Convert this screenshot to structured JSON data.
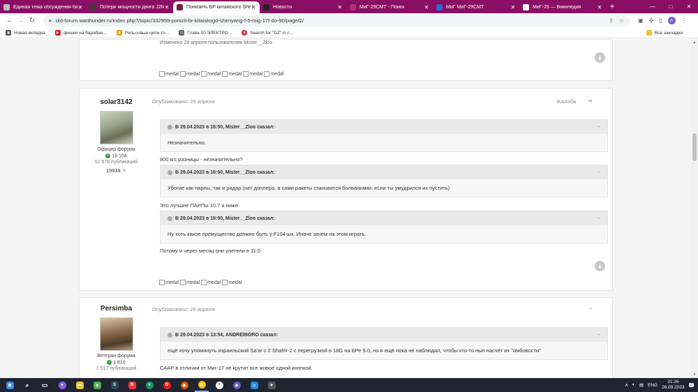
{
  "tabs": [
    {
      "title": "Единая тема обсуждения бала",
      "fav_color": "#c0c0c0",
      "active": false
    },
    {
      "title": "Потери мощности двига J2M5",
      "fav_color": "#3b3b3b",
      "active": false
    },
    {
      "title": "Понизить БР китайского Sheny",
      "fav_color": "#7a1f3d",
      "active": true
    },
    {
      "title": "Новости",
      "fav_color": "#222222",
      "active": false
    },
    {
      "title": "МиГ-29СМТ - Поиск",
      "fav_color": "#8a0e63",
      "active": false
    },
    {
      "title": "МиГ МиГ-29СМТ",
      "fav_color": "#2a6ad0",
      "active": false
    },
    {
      "title": "МиГ-29 — Википедия",
      "fav_color": "#ffffff",
      "active": false
    }
  ],
  "new_tab_label": "+",
  "window_controls": {
    "minimize": "—",
    "maximize": "□",
    "close": "✕"
  },
  "address": {
    "url": "old-forum.warthunder.ru/index.php?/topic/332959-ponizit-br-kitaiskogo-shenyang-f-5-mig-17f-do-90/page/2/"
  },
  "profile_initial": "A",
  "bookmarks": [
    {
      "label": "Новая вкладка",
      "color": "#555555"
    },
    {
      "label": "фишки на барабан...",
      "color": "#e02020"
    },
    {
      "label": "Рельсовые цепи то...",
      "color": "#f0a000"
    },
    {
      "label": "Глава 10 ЭЛЕКТРО...",
      "color": "#666666"
    },
    {
      "label": "Search for \"DZ\" in r...",
      "color": "#e03030"
    }
  ],
  "bookmarks_all": "Все закладки",
  "post0": {
    "edited": "Изменено 29 апреля пользователем Mister__Zloo",
    "medals": [
      "medal",
      "medal",
      "medal",
      "medal",
      "medal",
      "medal"
    ]
  },
  "post1": {
    "author": "solar3142",
    "rank": "Офицер форума",
    "reputation": "19 104",
    "posts": "51 978 публикаций",
    "extra": "19939",
    "published": "Опубликовано: 29 апреля",
    "report": "Жалоба",
    "quotes": [
      {
        "header": "В 29.04.2023 в 16:50, Mister__Zloo сказал:",
        "text": "Незначительно."
      },
      {
        "header": "В 29.04.2023 в 16:50, Mister__Zloo сказал:",
        "text": "Убогие как парпы, так и радар (нет доплера, а сами ракеты становятся болванками, если ты умудрился их пустить)"
      },
      {
        "header": "В 29.04.2023 в 16:50, Mister__Zloo сказал:",
        "text": "Ну хоть какое премущество должно быть у F104-ых. Иначе зачем на этом играть."
      }
    ],
    "replies": [
      "800 кгс разницы - незначительно?",
      "Это лучшие ПАРПы 10.7 и ниже.",
      "Потому и через месяц они улетели в 11.0."
    ],
    "medals": [
      "medal",
      "medal",
      "medal",
      "medal"
    ]
  },
  "post2": {
    "author": "Persimba",
    "rank": "Ветеран форума",
    "reputation": "1 810",
    "posts": "1 517 публикаций",
    "published": "Опубликовано: 29 апреля",
    "quote": {
      "header": "В 29.04.2023 в 13:54, ANDREIBORO сказал:",
      "text": "ещё хочу упомянуть израильский Sa'ar с 2 Shafrir-2 с перегрузкой в 18G на БРе 9.0, но я ещё пока не наблюдал, чтобы кто-то нып насчёт их \"имбовости\""
    },
    "reply": "СААР в отличии от Миг-17 не крутит все живое одной кнопкой."
  },
  "taskbar": {
    "apps": [
      {
        "name": "windows",
        "color": "#3a8ee6",
        "glyph": "⊞"
      },
      {
        "name": "search",
        "color": "#1f2430",
        "glyph": "⌕"
      },
      {
        "name": "taskview",
        "color": "#1f2430",
        "glyph": "▭"
      },
      {
        "name": "app1",
        "color": "#8a5cf0",
        "glyph": "●"
      },
      {
        "name": "explorer",
        "color": "#f2c230",
        "glyph": "▬"
      },
      {
        "name": "app2",
        "color": "#4caf50",
        "glyph": "◆"
      },
      {
        "name": "steam",
        "color": "#2a475e",
        "glyph": "S"
      },
      {
        "name": "yandex",
        "color": "#e53935",
        "glyph": "Я"
      },
      {
        "name": "edge",
        "color": "#0f9d58",
        "glyph": "e"
      },
      {
        "name": "opera",
        "color": "#e02020",
        "glyph": "O"
      },
      {
        "name": "app3",
        "color": "#e65100",
        "glyph": "◉"
      },
      {
        "name": "chrome",
        "color": "#fbbc05",
        "glyph": "◎"
      },
      {
        "name": "yandex-browser",
        "color": "#222222",
        "glyph": "Y"
      },
      {
        "name": "app4",
        "color": "#6a5acd",
        "glyph": "◈"
      },
      {
        "name": "shield",
        "color": "#1e88e5",
        "glyph": "◇"
      },
      {
        "name": "app5",
        "color": "#555555",
        "glyph": "✈"
      }
    ],
    "lang": "ENG",
    "time": "21:26",
    "date": "26.09.2023",
    "notification": "2"
  }
}
